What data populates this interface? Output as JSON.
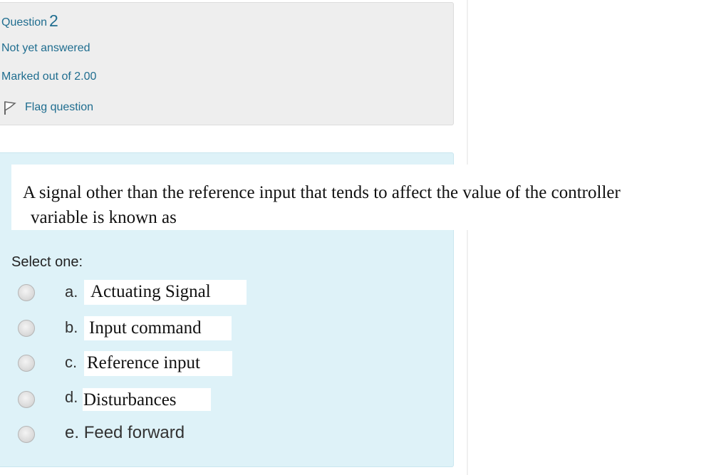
{
  "info": {
    "question_label": "Question",
    "question_number": "2",
    "state": "Not yet answered",
    "grade": "Marked out of 2.00",
    "flag_label": "Flag question"
  },
  "question": {
    "line1": "A signal other than the reference input that tends to affect the value of the controller",
    "line2": "variable is known as"
  },
  "prompt": "Select one:",
  "options": [
    {
      "letter": "a.",
      "text": "Actuating Signal"
    },
    {
      "letter": "b.",
      "text": "Input command"
    },
    {
      "letter": "c.",
      "text": "Reference input"
    },
    {
      "letter": "d.",
      "text": "Disturbances"
    },
    {
      "letter": "e.",
      "text": "Feed forward"
    }
  ],
  "colors": {
    "link": "#1f6d8f",
    "info_bg": "#eeeeee",
    "content_bg": "#def2f8"
  }
}
